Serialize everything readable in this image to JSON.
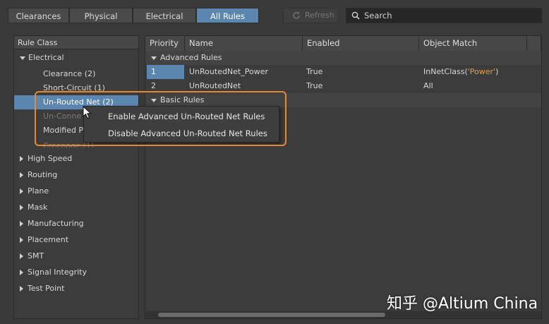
{
  "tabs": [
    {
      "label": "Clearances",
      "active": false
    },
    {
      "label": "Physical",
      "active": false
    },
    {
      "label": "Electrical",
      "active": false
    },
    {
      "label": "All Rules",
      "active": true
    }
  ],
  "toolbar": {
    "refresh_label": "Refresh",
    "search_label": "Search"
  },
  "left_panel": {
    "header": "Rule Class",
    "electrical": {
      "label": "Electrical",
      "children": [
        "Clearance (2)",
        "Short-Circuit (1)",
        "Un-Routed Net (2)",
        "Un-Conne",
        "Modified P",
        "Creepage (1)"
      ]
    },
    "classes": [
      "High Speed",
      "Routing",
      "Plane",
      "Mask",
      "Manufacturing",
      "Placement",
      "SMT",
      "Signal Integrity",
      "Test Point"
    ]
  },
  "grid": {
    "columns": [
      "Priority",
      "Name",
      "Enabled",
      "Object Match"
    ],
    "advanced_group": "Advanced Rules",
    "basic_group": "Basic Rules",
    "rows": [
      {
        "priority": "1",
        "name": "UnRoutedNet_Power",
        "enabled": "True",
        "match_prefix": "InNetClass(",
        "match_arg": "'Power'",
        "match_suffix": ")"
      },
      {
        "priority": "2",
        "name": "UnRoutedNet",
        "enabled": "True",
        "match_prefix": "All",
        "match_arg": "",
        "match_suffix": ""
      }
    ]
  },
  "context_menu": {
    "items": [
      "Enable Advanced Un-Routed Net Rules",
      "Disable Advanced Un-Routed Net Rules"
    ]
  },
  "watermark": "知乎 @Altium China",
  "colors": {
    "accent": "#5b86b0",
    "highlight": "#e8892f",
    "string": "#e0a040"
  }
}
